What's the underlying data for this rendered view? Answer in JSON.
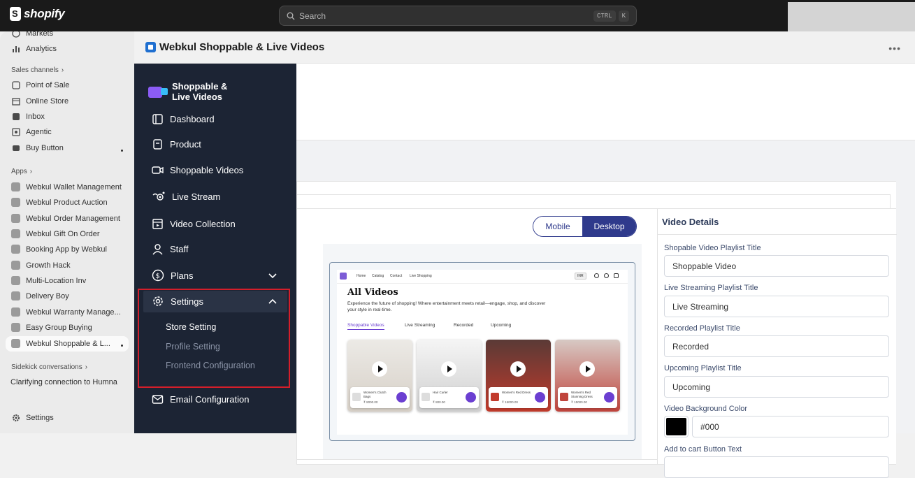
{
  "topbar": {
    "brand": "shopify",
    "search_placeholder": "Search",
    "shortcut_1": "CTRL",
    "shortcut_2": "K"
  },
  "leftnav": {
    "top_items": [
      {
        "label": "Markets",
        "icon": "globe-icon"
      },
      {
        "label": "Analytics",
        "icon": "bar-chart-icon"
      }
    ],
    "sales_channels_header": "Sales channels",
    "sales_channels": [
      {
        "label": "Point of Sale",
        "icon": "pos-icon"
      },
      {
        "label": "Online Store",
        "icon": "store-icon"
      },
      {
        "label": "Inbox",
        "icon": "inbox-icon"
      },
      {
        "label": "Agentic",
        "icon": "agentic-icon"
      },
      {
        "label": "Buy Button",
        "icon": "buy-button-icon"
      }
    ],
    "apps_header": "Apps",
    "apps": [
      {
        "label": "Webkul Wallet Management"
      },
      {
        "label": "Webkul Product Auction"
      },
      {
        "label": "Webkul Order Management"
      },
      {
        "label": "Webkul Gift On Order"
      },
      {
        "label": "Booking App by Webkul"
      },
      {
        "label": "Growth Hack"
      },
      {
        "label": "Multi-Location Inv"
      },
      {
        "label": "Delivery Boy"
      },
      {
        "label": "Webkul Warranty Manage..."
      },
      {
        "label": "Easy Group Buying"
      },
      {
        "label": "Webkul Shoppable & L..."
      }
    ],
    "sidekick_header": "Sidekick conversations",
    "sidekick_item": "Clarifying connection to Humna",
    "settings": "Settings"
  },
  "app": {
    "title": "Webkul Shoppable & Live Videos",
    "more": "•••"
  },
  "sidebar": {
    "brand_line1": "Shoppable &",
    "brand_line2": "Live Videos",
    "items": [
      {
        "label": "Dashboard",
        "icon": "dashboard-icon"
      },
      {
        "label": "Product",
        "icon": "product-icon"
      },
      {
        "label": "Shoppable Videos",
        "icon": "video-icon"
      },
      {
        "label": "Live Stream",
        "icon": "live-stream-icon"
      },
      {
        "label": "Video Collection",
        "icon": "video-collection-icon"
      },
      {
        "label": "Staff",
        "icon": "staff-icon"
      },
      {
        "label": "Plans",
        "icon": "plans-icon"
      },
      {
        "label": "Settings",
        "icon": "gear-icon"
      },
      {
        "label": "Email Configuration",
        "icon": "email-icon"
      }
    ],
    "settings_sub": [
      "Store Setting",
      "Profile Setting",
      "Frontend Configuration"
    ]
  },
  "preview": {
    "toggle_mobile": "Mobile",
    "toggle_desktop": "Desktop",
    "mock": {
      "nav": [
        "Home",
        "Catalog",
        "Contact",
        "Live Shopping"
      ],
      "currency": "INR",
      "title": "All Videos",
      "subtitle": "Experience the future of shopping! Where entertainment meets retail—engage, shop, and discover your style in real-time.",
      "tabs": [
        "Shoppable Videos",
        "Live Streaming",
        "Recorded",
        "Upcoming"
      ],
      "cards": [
        {
          "name": "Women's Clutch Bags",
          "price": "₹ 8000.00",
          "color": "#c9a98c"
        },
        {
          "name": "Hair Curler",
          "price": "₹ 800.00",
          "color": "#d9d9d9"
        },
        {
          "name": "Women's Red Dress",
          "price": "₹ 15000.00",
          "color": "#b8503f"
        },
        {
          "name": "Women's Red Stunning Dress",
          "price": "₹ 15000.00",
          "color": "#c9746a"
        }
      ]
    }
  },
  "details": {
    "header": "Video Details",
    "fields": [
      {
        "label": "Shopable Video Playlist Title",
        "value": "Shoppable Video"
      },
      {
        "label": "Live Streaming Playlist Title",
        "value": "Live Streaming"
      },
      {
        "label": "Recorded Playlist Title",
        "value": "Recorded"
      },
      {
        "label": "Upcoming Playlist Title",
        "value": "Upcoming"
      }
    ],
    "bg_color_label": "Video Background Color",
    "bg_color_value": "#000",
    "cart_label": "Add to cart Button Text"
  },
  "colors": {
    "sidebar_bg": "#1c2434",
    "accent": "#2f3a8c",
    "highlight": "#d41e2a"
  }
}
